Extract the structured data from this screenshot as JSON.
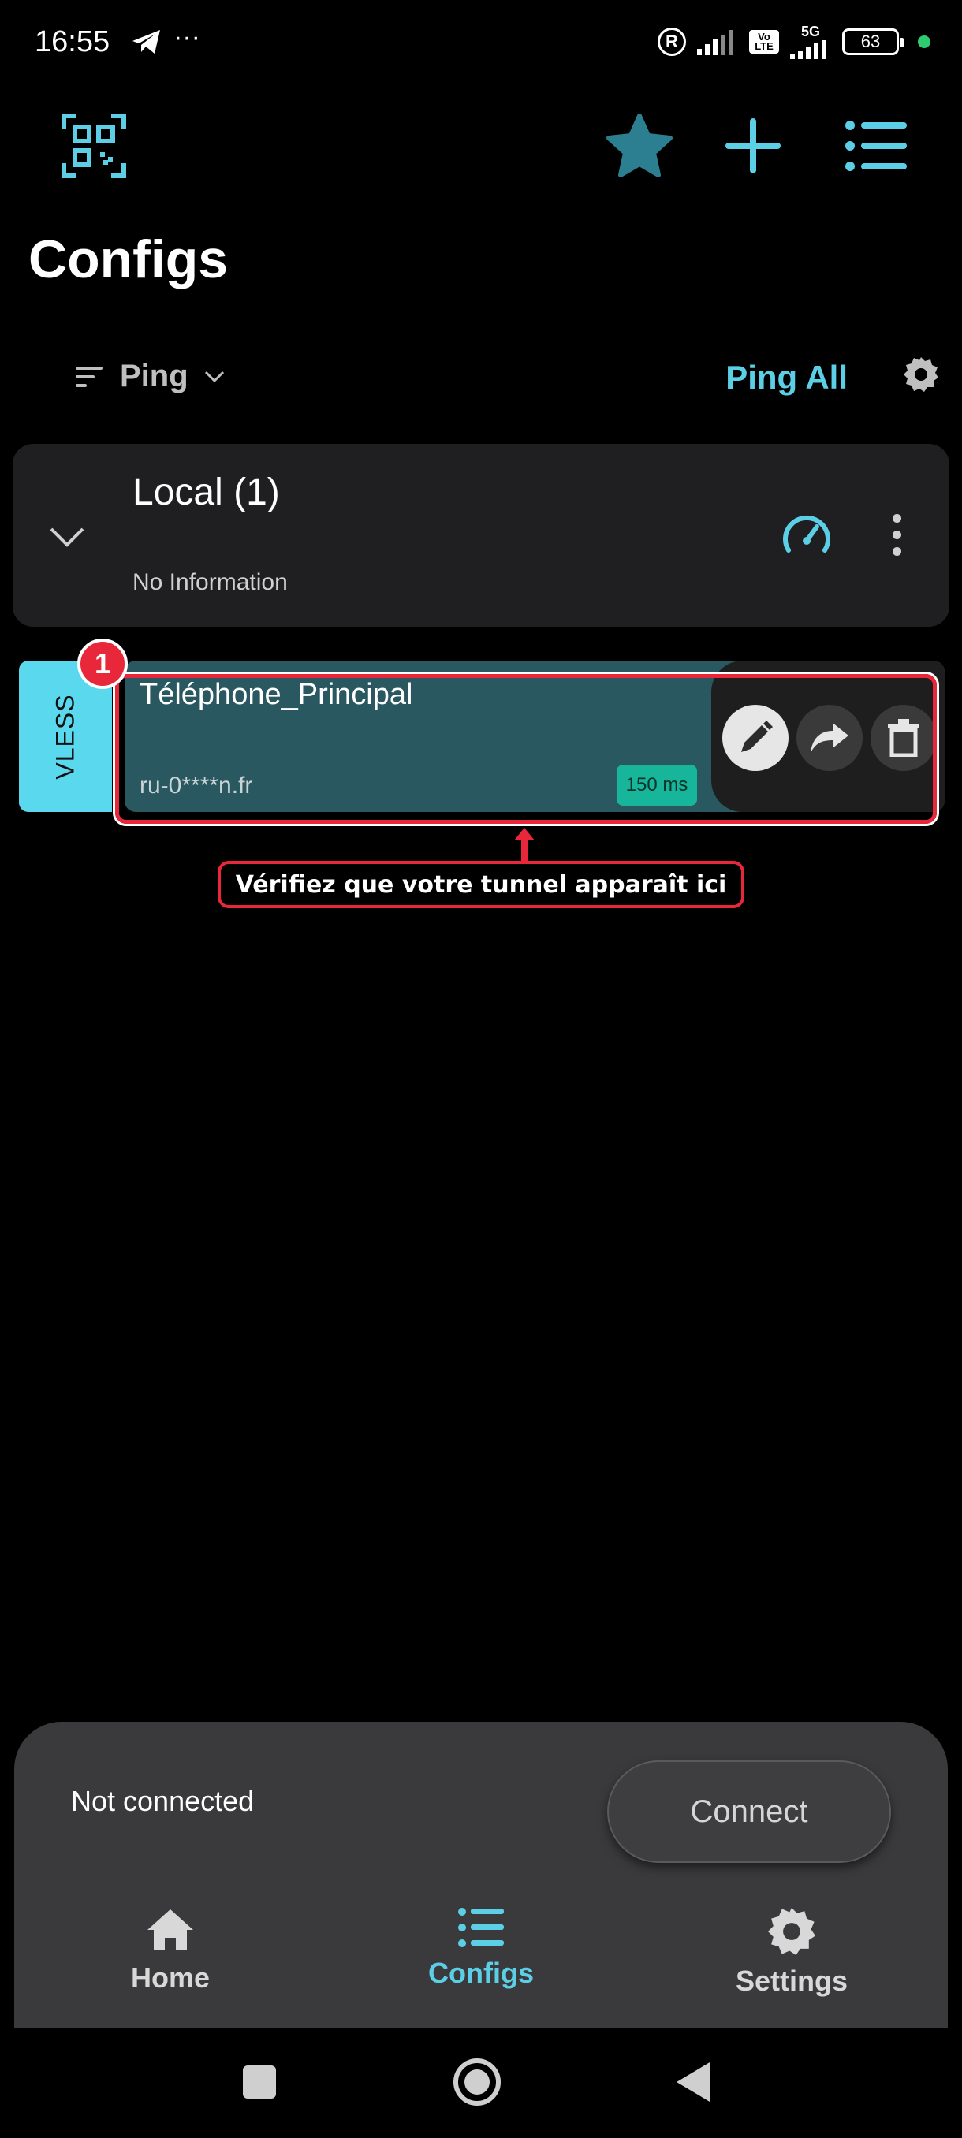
{
  "status_bar": {
    "time": "16:55",
    "more": "···",
    "network": "5G",
    "volte": "Vo LTE",
    "battery": "63"
  },
  "toolbar": {
    "title": "Configs",
    "icons": [
      "qr-scan-icon",
      "star-icon",
      "add-icon",
      "list-icon"
    ]
  },
  "sort": {
    "label": "Ping",
    "ping_all": "Ping All"
  },
  "group": {
    "title": "Local (1)",
    "info": "No Information"
  },
  "config": {
    "protocol": "VLESS",
    "name": "Téléphone_Principal",
    "host": "ru-0****n.fr",
    "ping": "150 ms"
  },
  "annotation": {
    "number": "1",
    "label": "Vérifiez que votre tunnel apparaît ici"
  },
  "connection": {
    "status": "Not connected",
    "button": "Connect"
  },
  "bottom_nav": {
    "items": [
      {
        "label": "Home",
        "icon": "home-icon"
      },
      {
        "label": "Configs",
        "icon": "list-icon"
      },
      {
        "label": "Settings",
        "icon": "gear-icon"
      }
    ],
    "active": "Configs"
  },
  "colors": {
    "accent": "#5ccfe6",
    "card": "#2a5861",
    "annotation": "#e8283a",
    "ping_badge": "#17b59a"
  }
}
